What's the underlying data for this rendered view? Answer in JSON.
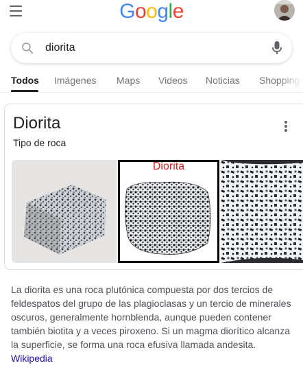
{
  "header": {
    "logo": {
      "letters": [
        "G",
        "o",
        "o",
        "g",
        "l",
        "e"
      ],
      "colors": [
        "#4285F4",
        "#EA4335",
        "#FBBC05",
        "#4285F4",
        "#34A853",
        "#EA4335"
      ]
    },
    "menu_icon": "hamburger-menu-icon",
    "avatar_icon": "user-avatar"
  },
  "search": {
    "query": "diorita",
    "search_icon": "search-icon",
    "mic_icon": "microphone-icon"
  },
  "tabs": [
    {
      "label": "Todos",
      "active": true
    },
    {
      "label": "Imágenes",
      "active": false
    },
    {
      "label": "Maps",
      "active": false
    },
    {
      "label": "Videos",
      "active": false
    },
    {
      "label": "Noticias",
      "active": false
    },
    {
      "label": "Shopping",
      "active": false
    }
  ],
  "knowledge_panel": {
    "title": "Diorita",
    "subtitle": "Tipo de roca",
    "more_icon": "more-vert-icon",
    "images": [
      {
        "name": "diorite-cube-photo"
      },
      {
        "name": "diorite-labeled-specimen",
        "caption": "Diorita"
      },
      {
        "name": "diorite-closeup-texture"
      }
    ],
    "description": "La diorita es una roca plutónica compuesta por dos tercios de feldespatos del grupo de las plagioclasas y un tercio de minerales oscuros, generalmente hornblenda, aunque pueden contener también biotita y a veces piroxeno. Si un magma diorítico alcanza la superficie, se forma una roca efusiva llamada andesita.",
    "source_link": "Wikipedia"
  },
  "colors": {
    "link": "#1a0dab",
    "text_secondary": "#70757a",
    "caption_red": "#d32020"
  }
}
